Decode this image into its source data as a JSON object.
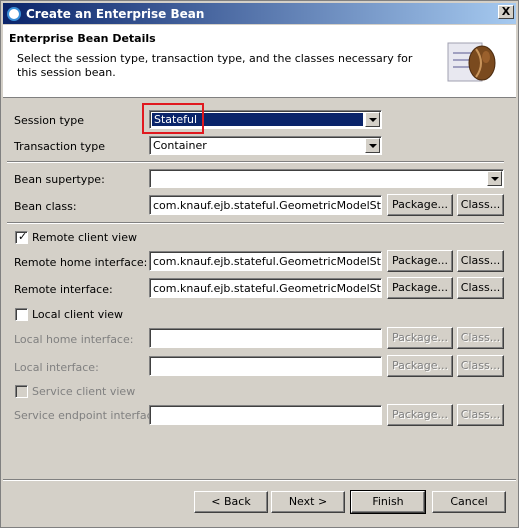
{
  "window": {
    "title": "Create an Enterprise Bean"
  },
  "header": {
    "title": "Enterprise Bean Details",
    "description": "Select the session type, transaction type, and the classes necessary for this session bean."
  },
  "session_type": {
    "label": "Session type",
    "value": "Stateful"
  },
  "transaction_type": {
    "label": "Transaction type",
    "value": "Container"
  },
  "bean_supertype": {
    "label": "Bean supertype:",
    "value": ""
  },
  "bean_class": {
    "label": "Bean class:",
    "value": "com.knauf.ejb.stateful.GeometricModelStoreB"
  },
  "remote_client_view": {
    "label": "Remote client view",
    "checked": true
  },
  "remote_home_interface": {
    "label": "Remote home interface:",
    "value": "com.knauf.ejb.stateful.GeometricModelStoreH"
  },
  "remote_interface": {
    "label": "Remote interface:",
    "value": "com.knauf.ejb.stateful.GeometricModelStore"
  },
  "local_client_view": {
    "label": "Local client view",
    "checked": false
  },
  "local_home_interface": {
    "label": "Local home interface:",
    "value": ""
  },
  "local_interface": {
    "label": "Local interface:",
    "value": ""
  },
  "service_client_view": {
    "label": "Service client view",
    "checked": false
  },
  "service_endpoint_interface": {
    "label": "Service endpoint interface:",
    "value": ""
  },
  "buttons": {
    "package": "Package...",
    "class": "Class...",
    "back": "< Back",
    "next": "Next >",
    "finish": "Finish",
    "cancel": "Cancel",
    "close": "X"
  }
}
